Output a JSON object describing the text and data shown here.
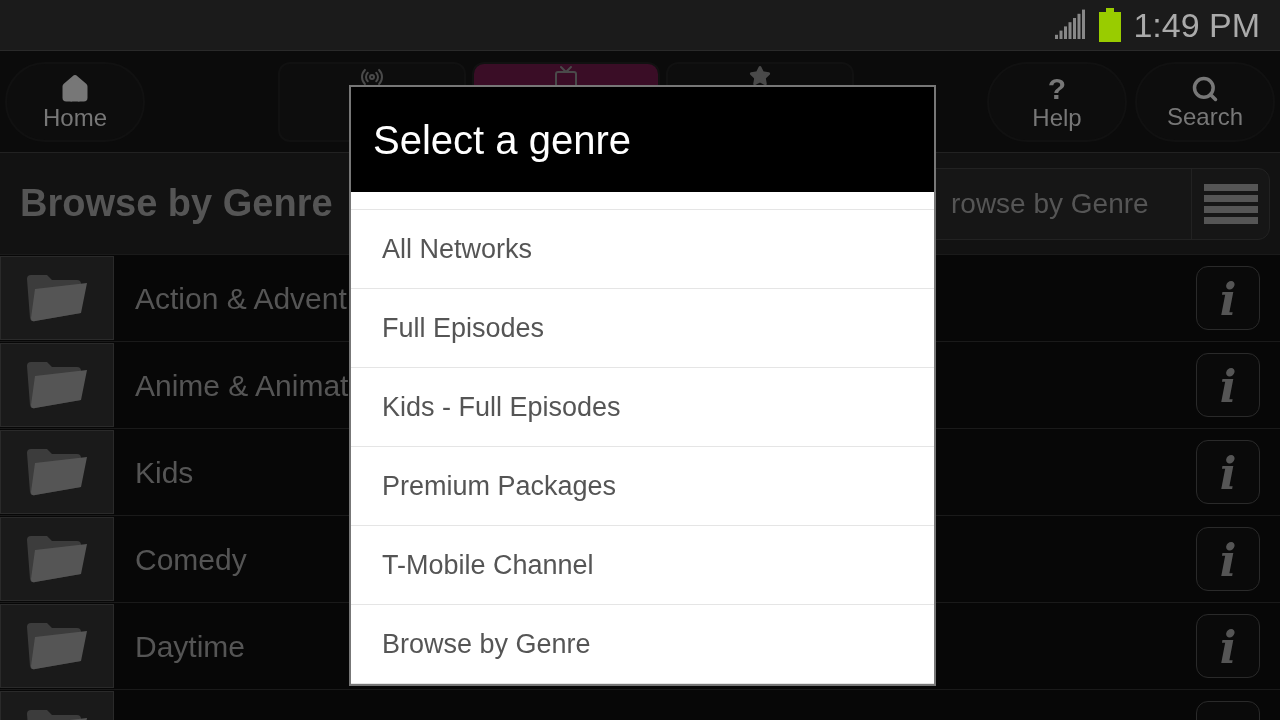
{
  "status_bar": {
    "time": "1:49 PM"
  },
  "nav": {
    "left": [
      {
        "kind": "home",
        "label": "Home"
      }
    ],
    "tabs": [
      {
        "kind": "antenna",
        "selected": false
      },
      {
        "kind": "tv",
        "selected": true
      },
      {
        "kind": "star",
        "selected": false
      }
    ],
    "right": [
      {
        "kind": "help",
        "label": "Help",
        "glyph": "?"
      },
      {
        "kind": "search",
        "label": "Search"
      }
    ]
  },
  "header": {
    "title": "Browse by Genre",
    "selector": "rowse by Genre"
  },
  "rows": [
    {
      "label": "Action & Advent",
      "info": "i"
    },
    {
      "label": "Anime & Animat",
      "info": "i"
    },
    {
      "label": "Kids",
      "info": "i"
    },
    {
      "label": "Comedy",
      "info": "i"
    },
    {
      "label": "Daytime",
      "info": "i"
    },
    {}
  ],
  "dialog": {
    "title": "Select a genre",
    "items": [
      {
        "label": "All Networks"
      },
      {
        "label": "Full Episodes"
      },
      {
        "label": "Kids - Full Episodes"
      },
      {
        "label": "Premium Packages"
      },
      {
        "label": "T-Mobile Channel"
      },
      {
        "label": "Browse by Genre"
      }
    ]
  }
}
